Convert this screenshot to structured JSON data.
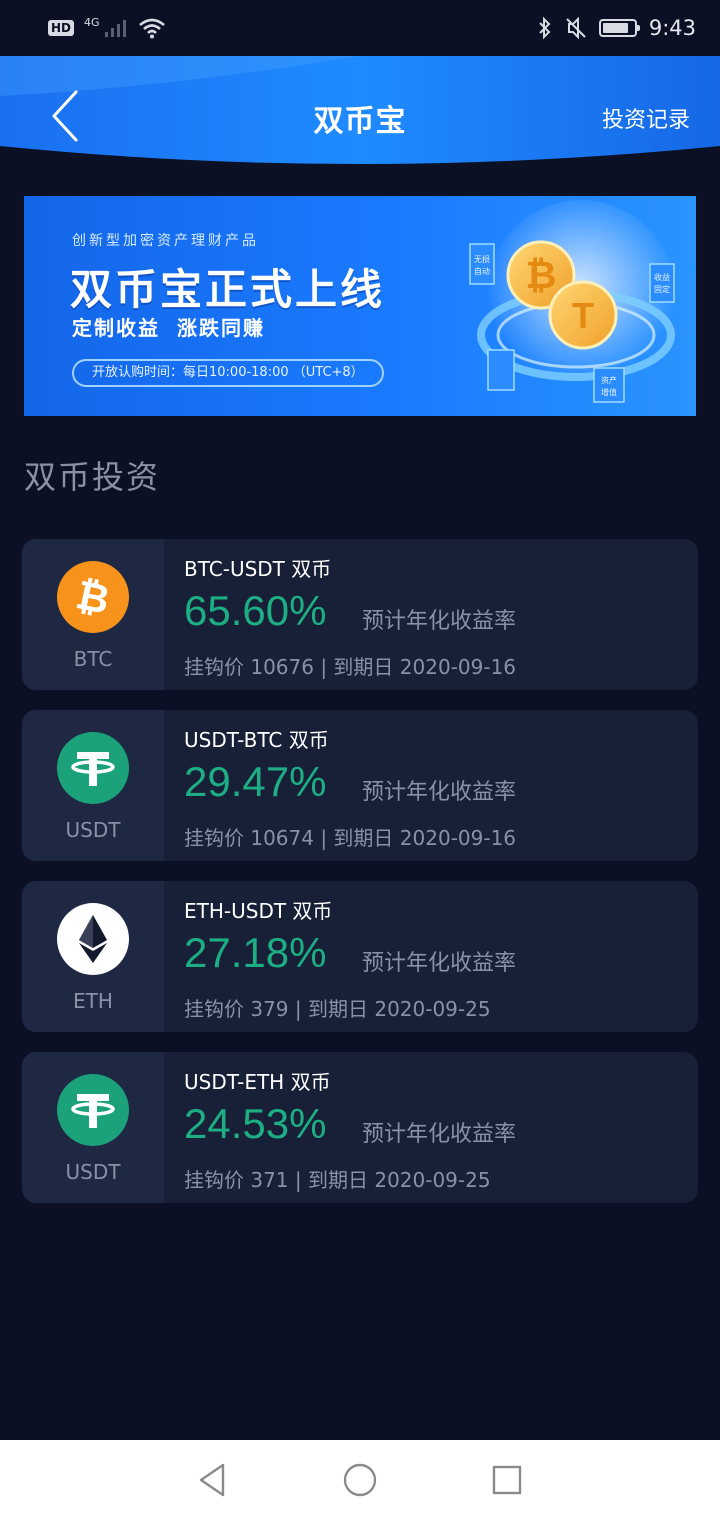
{
  "status_bar": {
    "hd_label": "HD",
    "network_label": "4G",
    "time": "9:43",
    "icons": [
      "signal-icon",
      "wifi-icon",
      "bluetooth-icon",
      "mute-icon",
      "battery-icon"
    ]
  },
  "header": {
    "title": "双币宝",
    "action_label": "投资记录",
    "back_icon": "chevron-left-icon"
  },
  "banner": {
    "subtitle": "创新型加密资产理财产品",
    "title": "双币宝正式上线",
    "slogan": "定制收益  涨跌同赚",
    "hours": "开放认购时间：每日10:00-18:00 （UTC+8）",
    "art_tags": [
      "无损",
      "自动",
      "收益",
      "固定",
      "资产",
      "增值"
    ]
  },
  "section": {
    "title": "双币投资"
  },
  "products": [
    {
      "coin": "BTC",
      "pair": "BTC-USDT 双币",
      "rate": "65.60%",
      "rate_label": "预计年化收益率",
      "meta": "挂钩价 10676 | 到期日 2020-09-16",
      "icon": "bitcoin-icon",
      "color": "#f7931a"
    },
    {
      "coin": "USDT",
      "pair": "USDT-BTC 双币",
      "rate": "29.47%",
      "rate_label": "预计年化收益率",
      "meta": "挂钩价 10674 | 到期日 2020-09-16",
      "icon": "tether-icon",
      "color": "#1ba27a"
    },
    {
      "coin": "ETH",
      "pair": "ETH-USDT 双币",
      "rate": "27.18%",
      "rate_label": "预计年化收益率",
      "meta": "挂钩价 379 | 到期日 2020-09-25",
      "icon": "ethereum-icon",
      "color": "#ffffff"
    },
    {
      "coin": "USDT",
      "pair": "USDT-ETH 双币",
      "rate": "24.53%",
      "rate_label": "预计年化收益率",
      "meta": "挂钩价 371 | 到期日 2020-09-25",
      "icon": "tether-icon",
      "color": "#1ba27a"
    }
  ],
  "colors": {
    "background": "#0b1024",
    "card": "#182038",
    "rate_green": "#1dae84",
    "header_blue": "#1677ff",
    "muted_text": "#8a91a6"
  },
  "nav_bar": {
    "icons": [
      "back-triangle-icon",
      "home-circle-icon",
      "recents-square-icon"
    ]
  }
}
